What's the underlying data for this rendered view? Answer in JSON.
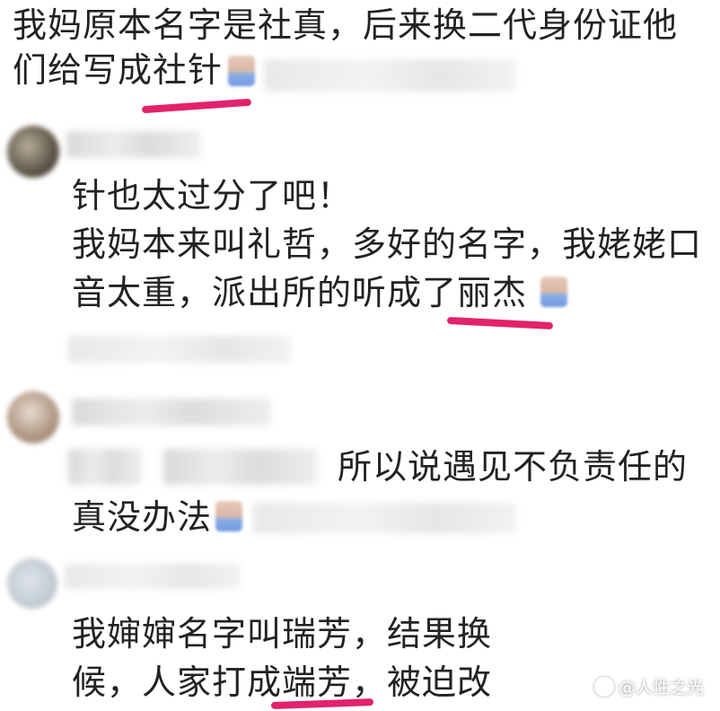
{
  "comments": [
    {
      "lines": [
        "我妈原本名字是社真，后来换二代身份证他",
        "们给写成社针"
      ]
    },
    {
      "lines": [
        "针也太过分了吧！",
        "我妈本来叫礼哲，多好的名字，我姥姥口",
        "音太重，派出所的听成了丽杰"
      ]
    },
    {
      "lines": [
        "所以说遇见不负责任的",
        "真没办法"
      ]
    },
    {
      "lines": [
        "我婶婶名字叫瑞芳，结果换",
        "候，人家打成端芳，被迫改"
      ]
    }
  ],
  "colors": {
    "highlight": "#e2226b",
    "text": "#222222"
  },
  "watermark": {
    "icon": "paw-logo-icon",
    "text": "@人性之光"
  }
}
